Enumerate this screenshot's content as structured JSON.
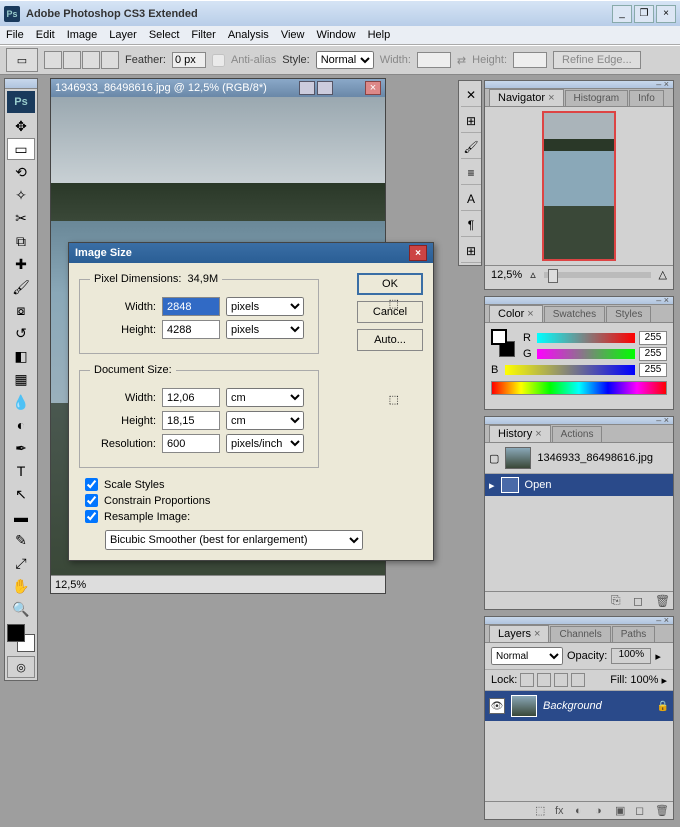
{
  "titlebar": {
    "app_name": "Adobe Photoshop CS3 Extended"
  },
  "menubar": [
    "File",
    "Edit",
    "Image",
    "Layer",
    "Select",
    "Filter",
    "Analysis",
    "View",
    "Window",
    "Help"
  ],
  "optionsbar": {
    "feather_label": "Feather:",
    "feather_value": "0 px",
    "antialias_label": "Anti-alias",
    "style_label": "Style:",
    "style_value": "Normal",
    "width_label": "Width:",
    "height_label": "Height:",
    "refine_label": "Refine Edge..."
  },
  "document": {
    "title": "1346933_86498616.jpg @ 12,5% (RGB/8*)",
    "zoom": "12,5%"
  },
  "dialog": {
    "title": "Image Size",
    "pixel_dims_label": "Pixel Dimensions:",
    "pixel_dims_value": "34,9M",
    "width_label": "Width:",
    "height_label": "Height:",
    "resolution_label": "Resolution:",
    "px_width": "2848",
    "px_height": "4288",
    "px_unit": "pixels",
    "doc_size_label": "Document Size:",
    "doc_width": "12,06",
    "doc_height": "18,15",
    "doc_unit": "cm",
    "resolution": "600",
    "res_unit": "pixels/inch",
    "scale_styles": "Scale Styles",
    "constrain": "Constrain Proportions",
    "resample": "Resample Image:",
    "resample_method": "Bicubic Smoother (best for enlargement)",
    "ok": "OK",
    "cancel": "Cancel",
    "auto": "Auto..."
  },
  "navigator": {
    "tabs": [
      "Navigator",
      "Histogram",
      "Info"
    ],
    "zoom": "12,5%"
  },
  "color": {
    "tabs": [
      "Color",
      "Swatches",
      "Styles"
    ],
    "r": "R",
    "g": "G",
    "b": "B",
    "r_val": "255",
    "g_val": "255",
    "b_val": "255"
  },
  "history": {
    "tabs": [
      "History",
      "Actions"
    ],
    "snapshot": "1346933_86498616.jpg",
    "state": "Open"
  },
  "layers": {
    "tabs": [
      "Layers",
      "Channels",
      "Paths"
    ],
    "blend_mode": "Normal",
    "opacity_label": "Opacity:",
    "opacity": "100%",
    "lock_label": "Lock:",
    "fill_label": "Fill:",
    "fill": "100%",
    "layer_name": "Background"
  }
}
